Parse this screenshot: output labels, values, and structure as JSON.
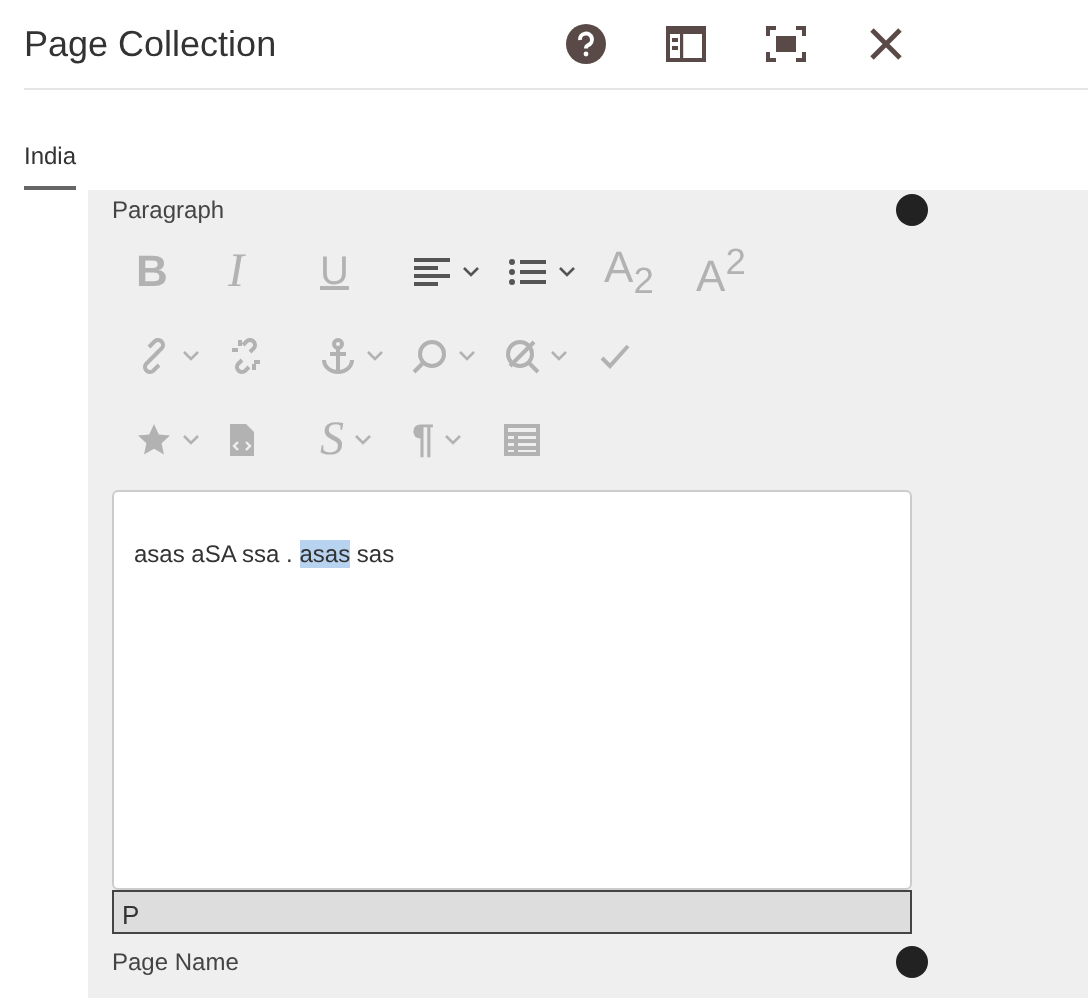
{
  "header": {
    "title": "Page Collection",
    "actions": [
      {
        "kind": "help"
      },
      {
        "kind": "sidepanel"
      },
      {
        "kind": "fullscreen"
      },
      {
        "kind": "close"
      }
    ]
  },
  "tabs": [
    {
      "label": "India",
      "selected": true
    }
  ],
  "rte": {
    "label": "Paragraph",
    "toolbar_rows": [
      [
        {
          "kind": "bold",
          "glyph": "B",
          "disabled": true,
          "dropdown": false
        },
        {
          "kind": "italic",
          "glyph": "I",
          "disabled": true,
          "dropdown": false
        },
        {
          "kind": "underline",
          "glyph": "U",
          "disabled": true,
          "dropdown": false
        },
        {
          "kind": "align",
          "disabled": false,
          "dropdown": true
        },
        {
          "kind": "list",
          "disabled": false,
          "dropdown": true
        },
        {
          "kind": "subscript",
          "glyph": "A$_{2}$",
          "disabled": true,
          "dropdown": false
        },
        {
          "kind": "superscript",
          "glyph": "A$^{2}$",
          "disabled": true,
          "dropdown": false
        }
      ],
      [
        {
          "kind": "link",
          "disabled": true,
          "dropdown": true
        },
        {
          "kind": "unlink",
          "disabled": true,
          "dropdown": false
        },
        {
          "kind": "anchor",
          "disabled": true,
          "dropdown": true
        },
        {
          "kind": "find",
          "disabled": true,
          "dropdown": true
        },
        {
          "kind": "replace",
          "disabled": true,
          "dropdown": true
        },
        {
          "kind": "spellcheck",
          "disabled": true,
          "dropdown": false
        }
      ],
      [
        {
          "kind": "special",
          "disabled": true,
          "dropdown": true
        },
        {
          "kind": "source",
          "disabled": true,
          "dropdown": false
        },
        {
          "kind": "styles",
          "glyph": "S",
          "disabled": true,
          "dropdown": true
        },
        {
          "kind": "paragraph",
          "glyph": "¶",
          "disabled": true,
          "dropdown": true
        },
        {
          "kind": "table",
          "disabled": true,
          "dropdown": false
        }
      ]
    ],
    "text_before": "asas aSA ssa . ",
    "selection": "asas",
    "text_after": " sas",
    "path": "P"
  },
  "next_field": {
    "label": "Page Name"
  }
}
